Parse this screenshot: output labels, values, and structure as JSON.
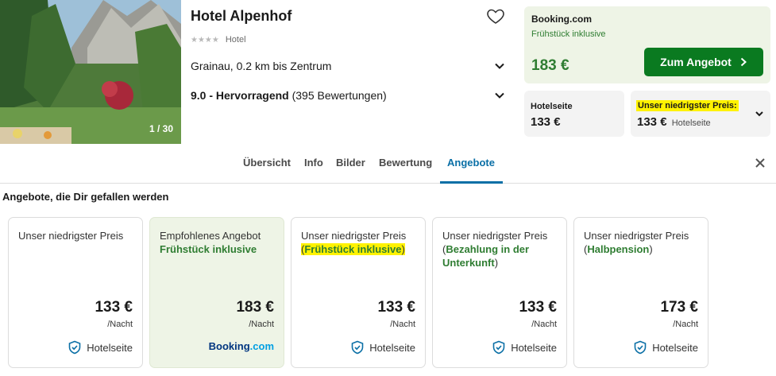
{
  "hotel": {
    "name": "Hotel Alpenhof",
    "category": "Hotel",
    "stars": "★★★★",
    "location": "Grainau, 0.2 km bis Zentrum",
    "rating_bold": "9.0 - Hervorragend",
    "rating_count": "(395 Bewertungen)",
    "image_counter": "1 / 30"
  },
  "top_deal": {
    "provider": "Booking.com",
    "subtitle": "Frühstück inklusive",
    "price": "183 €",
    "button_label": "Zum Angebot"
  },
  "alt_offers": [
    {
      "label": "Hotelseite",
      "price": "133 €"
    },
    {
      "label": "Unser niedrigster Preis:",
      "price": "133 €",
      "source": "Hotelseite"
    }
  ],
  "tabs": [
    "Übersicht",
    "Info",
    "Bilder",
    "Bewertung",
    "Angebote"
  ],
  "active_tab": "Angebote",
  "section_title": "Angebote, die Dir gefallen werden",
  "cards": [
    {
      "title_line": "Unser niedrigster Preis",
      "detail": "",
      "price": "133 €",
      "per": "/Nacht",
      "provider": "Hotelseite"
    },
    {
      "title_line": "Empfohlenes Angebot",
      "detail": "Frühstück inklusive",
      "price": "183 €",
      "per": "/Nacht",
      "provider": "Booking.com"
    },
    {
      "title_line": "Unser niedrigster Preis",
      "detail": "Frühstück inklusive",
      "price": "133 €",
      "per": "/Nacht",
      "provider": "Hotelseite"
    },
    {
      "title_line": "Unser niedrigster Preis",
      "detail": "Bezahlung in der Unterkunft",
      "price": "133 €",
      "per": "/Nacht",
      "provider": "Hotelseite"
    },
    {
      "title_line": "Unser niedrigster Preis",
      "detail": "Halbpension",
      "price": "173 €",
      "per": "/Nacht",
      "provider": "Hotelseite"
    }
  ],
  "colors": {
    "accent_green": "#0a7a20",
    "text_green": "#2f7d32",
    "tab_active": "#0a6fa6",
    "highlight": "#fff200",
    "booking_blue": "#003580"
  },
  "icons": [
    "heart-icon",
    "chevron-down-icon",
    "chevron-right-icon",
    "close-icon",
    "shield-check-icon"
  ]
}
